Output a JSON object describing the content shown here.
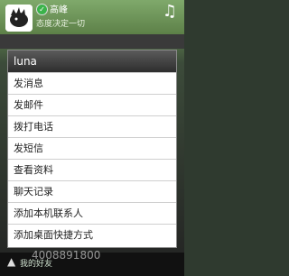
{
  "contact": {
    "name": "高峰",
    "signature": "态度决定一切",
    "check_glyph": "✓",
    "music_glyph": "♫"
  },
  "dialog": {
    "title": "luna",
    "items": [
      {
        "label": "发消息"
      },
      {
        "label": "发邮件"
      },
      {
        "label": "拨打电话"
      },
      {
        "label": "发短信"
      },
      {
        "label": "查看资料"
      },
      {
        "label": "聊天记录"
      },
      {
        "label": "添加本机联系人"
      },
      {
        "label": "添加桌面快捷方式"
      }
    ]
  },
  "footer": {
    "label": "我的好友",
    "watermark": "4008891800"
  }
}
